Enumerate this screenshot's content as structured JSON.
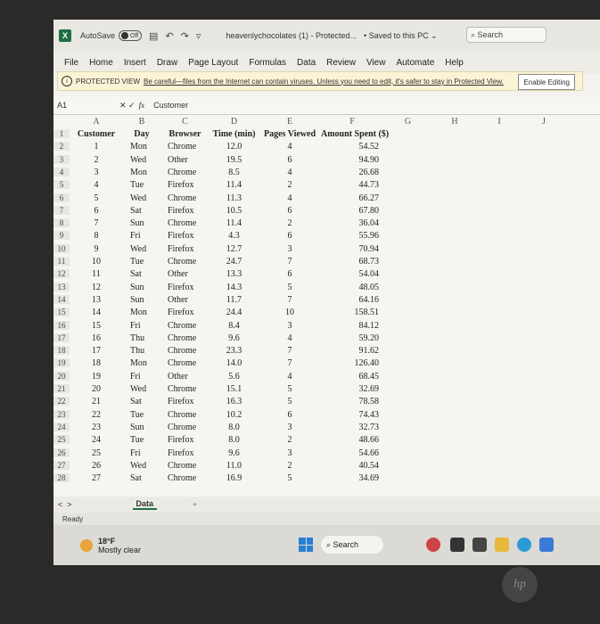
{
  "titlebar": {
    "autosave_label": "AutoSave",
    "autosave_state": "Off",
    "filename": "heavenlychocolates (1) - Protected...",
    "saved_status": "• Saved to this PC ⌄",
    "search_label": "Search"
  },
  "menu": [
    "File",
    "Home",
    "Insert",
    "Draw",
    "Page Layout",
    "Formulas",
    "Data",
    "Review",
    "View",
    "Automate",
    "Help"
  ],
  "protected": {
    "label": "PROTECTED VIEW",
    "message": "Be careful—files from the Internet can contain viruses. Unless you need to edit, it's safer to stay in Protected View.",
    "button": "Enable Editing"
  },
  "formula": {
    "namebox": "A1",
    "fx": "fx",
    "content": "Customer"
  },
  "columns": [
    "A",
    "B",
    "C",
    "D",
    "E",
    "F",
    "G",
    "H",
    "I",
    "J"
  ],
  "headers": [
    "Customer",
    "Day",
    "Browser",
    "Time (min)",
    "Pages Viewed",
    "Amount Spent ($)"
  ],
  "rows": [
    [
      "1",
      "Mon",
      "Chrome",
      "12.0",
      "4",
      "54.52"
    ],
    [
      "2",
      "Wed",
      "Other",
      "19.5",
      "6",
      "94.90"
    ],
    [
      "3",
      "Mon",
      "Chrome",
      "8.5",
      "4",
      "26.68"
    ],
    [
      "4",
      "Tue",
      "Firefox",
      "11.4",
      "2",
      "44.73"
    ],
    [
      "5",
      "Wed",
      "Chrome",
      "11.3",
      "4",
      "66.27"
    ],
    [
      "6",
      "Sat",
      "Firefox",
      "10.5",
      "6",
      "67.80"
    ],
    [
      "7",
      "Sun",
      "Chrome",
      "11.4",
      "2",
      "36.04"
    ],
    [
      "8",
      "Fri",
      "Firefox",
      "4.3",
      "6",
      "55.96"
    ],
    [
      "9",
      "Wed",
      "Firefox",
      "12.7",
      "3",
      "70.94"
    ],
    [
      "10",
      "Tue",
      "Chrome",
      "24.7",
      "7",
      "68.73"
    ],
    [
      "11",
      "Sat",
      "Other",
      "13.3",
      "6",
      "54.04"
    ],
    [
      "12",
      "Sun",
      "Firefox",
      "14.3",
      "5",
      "48.05"
    ],
    [
      "13",
      "Sun",
      "Other",
      "11.7",
      "7",
      "64.16"
    ],
    [
      "14",
      "Mon",
      "Firefox",
      "24.4",
      "10",
      "158.51"
    ],
    [
      "15",
      "Fri",
      "Chrome",
      "8.4",
      "3",
      "84.12"
    ],
    [
      "16",
      "Thu",
      "Chrome",
      "9.6",
      "4",
      "59.20"
    ],
    [
      "17",
      "Thu",
      "Chrome",
      "23.3",
      "7",
      "91.62"
    ],
    [
      "18",
      "Mon",
      "Chrome",
      "14.0",
      "7",
      "126.40"
    ],
    [
      "19",
      "Fri",
      "Other",
      "5.6",
      "4",
      "68.45"
    ],
    [
      "20",
      "Wed",
      "Chrome",
      "15.1",
      "5",
      "32.69"
    ],
    [
      "21",
      "Sat",
      "Firefox",
      "16.3",
      "5",
      "78.58"
    ],
    [
      "22",
      "Tue",
      "Chrome",
      "10.2",
      "6",
      "74.43"
    ],
    [
      "23",
      "Sun",
      "Chrome",
      "8.0",
      "3",
      "32.73"
    ],
    [
      "24",
      "Tue",
      "Firefox",
      "8.0",
      "2",
      "48.66"
    ],
    [
      "25",
      "Fri",
      "Firefox",
      "9.6",
      "3",
      "54.66"
    ],
    [
      "26",
      "Wed",
      "Chrome",
      "11.0",
      "2",
      "40.54"
    ],
    [
      "27",
      "Sat",
      "Chrome",
      "16.9",
      "5",
      "34.69"
    ]
  ],
  "sheet_tab": "Data",
  "status": "Ready",
  "weather": {
    "temp": "18°F",
    "desc": "Mostly clear"
  },
  "taskbar_search": "Search",
  "brand": "hp"
}
